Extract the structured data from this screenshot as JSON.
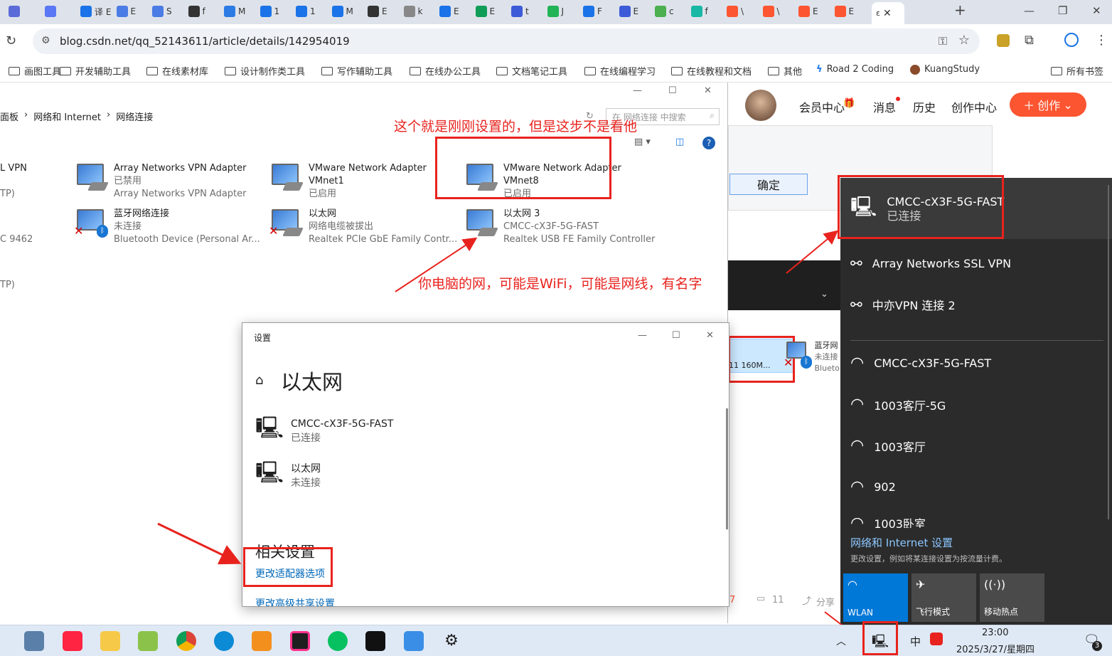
{
  "browser": {
    "tabs": [
      {
        "title": "",
        "icon": "tab-icon-1",
        "color": "#5b6cd8"
      },
      {
        "title": "",
        "icon": "tab-icon-2",
        "color": "#5a78f5"
      },
      {
        "title": "译 E",
        "icon": "tab-icon-3",
        "color": "#1a73e8"
      },
      {
        "title": "E",
        "icon": "tab-icon-4",
        "color": "#4b7be5"
      },
      {
        "title": "S",
        "icon": "tab-icon-5",
        "color": "#4b7be5"
      },
      {
        "title": "f",
        "icon": "tab-icon-6",
        "color": "#333333"
      },
      {
        "title": "M",
        "icon": "tab-icon-7",
        "color": "#2c7be5"
      },
      {
        "title": "1",
        "icon": "tab-icon-8",
        "color": "#1a73e8"
      },
      {
        "title": "1",
        "icon": "tab-icon-9",
        "color": "#1a73e8"
      },
      {
        "title": "M",
        "icon": "tab-icon-10",
        "color": "#1a73e8"
      },
      {
        "title": "E",
        "icon": "tab-icon-11",
        "color": "#333333"
      },
      {
        "title": "k",
        "icon": "tab-icon-12",
        "color": "#888888"
      },
      {
        "title": "E",
        "icon": "tab-icon-13",
        "color": "#1a73e8"
      },
      {
        "title": "E",
        "icon": "tab-icon-14",
        "color": "#0f9d58"
      },
      {
        "title": "t",
        "icon": "tab-icon-15",
        "color": "#3c5bd8"
      },
      {
        "title": "J",
        "icon": "tab-icon-16",
        "color": "#21b355"
      },
      {
        "title": "F",
        "icon": "tab-icon-17",
        "color": "#1a73e8"
      },
      {
        "title": "E",
        "icon": "tab-icon-18",
        "color": "#3c5bd8"
      },
      {
        "title": "c",
        "icon": "tab-icon-19",
        "color": "#4caf50"
      },
      {
        "title": "f",
        "icon": "tab-icon-20",
        "color": "#19b8a5"
      },
      {
        "title": "\\",
        "icon": "tab-icon-21",
        "color": "#fc5531"
      },
      {
        "title": "\\",
        "icon": "tab-icon-22",
        "color": "#fc5531"
      },
      {
        "title": "E",
        "icon": "tab-icon-23",
        "color": "#fc5531"
      },
      {
        "title": "E",
        "icon": "tab-icon-24",
        "color": "#fc5531"
      }
    ],
    "new_tab": "+",
    "url": "blog.csdn.net/qq_52143611/article/details/142954019",
    "bookmarks": [
      "画图工具",
      "开发辅助工具",
      "在线素材库",
      "设计制作类工具",
      "写作辅助工具",
      "在线办公工具",
      "文档笔记工具",
      "在线编程学习",
      "在线教程和文档",
      "其他"
    ],
    "bookmark_road": "Road 2 Coding",
    "bookmark_kuang": "KuangStudy",
    "bookmark_all": "所有书签"
  },
  "network_window": {
    "breadcrumb": [
      "面板",
      "网络和 Internet",
      "网络连接"
    ],
    "search_placeholder": "在 网络连接 中搜索",
    "left_items": [
      "L VPN",
      "TP)",
      "C 9462",
      "TP)"
    ],
    "adapters": [
      {
        "name": "Array Networks VPN Adapter",
        "status": "已禁用",
        "device": "Array Networks VPN Adapter"
      },
      {
        "name": "VMware Network Adapter VMnet1",
        "status": "已启用",
        "device": ""
      },
      {
        "name": "VMware Network Adapter VMnet8",
        "status": "已启用",
        "device": ""
      },
      {
        "name": "蓝牙网络连接",
        "status": "未连接",
        "device": "Bluetooth Device (Personal Ar..."
      },
      {
        "name": "以太网",
        "status": "网络电缆被拔出",
        "device": "Realtek PCIe GbE Family Contr..."
      },
      {
        "name": "以太网 3",
        "status": "CMCC-cX3F-5G-FAST",
        "device": "Realtek USB FE Family Controller"
      }
    ]
  },
  "annotations": {
    "note1": "这个就是刚刚设置的，但是这步不是看他",
    "note2": "你电脑的网，可能是WiFi，可能是网线，有名字"
  },
  "csdn": {
    "nav": [
      "会员中心",
      "消息",
      "历史",
      "创作中心"
    ],
    "create_button": "创作",
    "confirm_button": "确定",
    "partial_card_text": "11 160M...",
    "partial_name": "蓝牙网",
    "partial_status": "未连接",
    "partial_device": "Blueto",
    "footer_count": "11",
    "footer_share": "分享",
    "footer_num": "7"
  },
  "settings_window": {
    "title": "设置",
    "heading": "以太网",
    "connections": [
      {
        "name": "CMCC-cX3F-5G-FAST",
        "status": "已连接"
      },
      {
        "name": "以太网",
        "status": "未连接"
      }
    ],
    "related_heading": "相关设置",
    "link1": "更改适配器选项",
    "link2": "更改高级共享设置"
  },
  "network_flyout": {
    "connected": {
      "name": "CMCC-cX3F-5G-FAST",
      "status": "已连接"
    },
    "vpns": [
      "Array Networks SSL VPN",
      "中亦VPN 连接 2"
    ],
    "wifis": [
      "CMCC-cX3F-5G-FAST",
      "1003客厅-5G",
      "1003客厅",
      "902",
      "1003卧室"
    ],
    "settings_link": "网络和 Internet 设置",
    "settings_desc": "更改设置，例如将某连接设置为按流量计费。",
    "tiles": [
      "WLAN",
      "飞行模式",
      "移动热点"
    ],
    "accent": "#0078d7"
  },
  "taskbar": {
    "time": "23:00",
    "date": "2025/3/27/星期四",
    "ime": "中",
    "notify_count": "3"
  }
}
